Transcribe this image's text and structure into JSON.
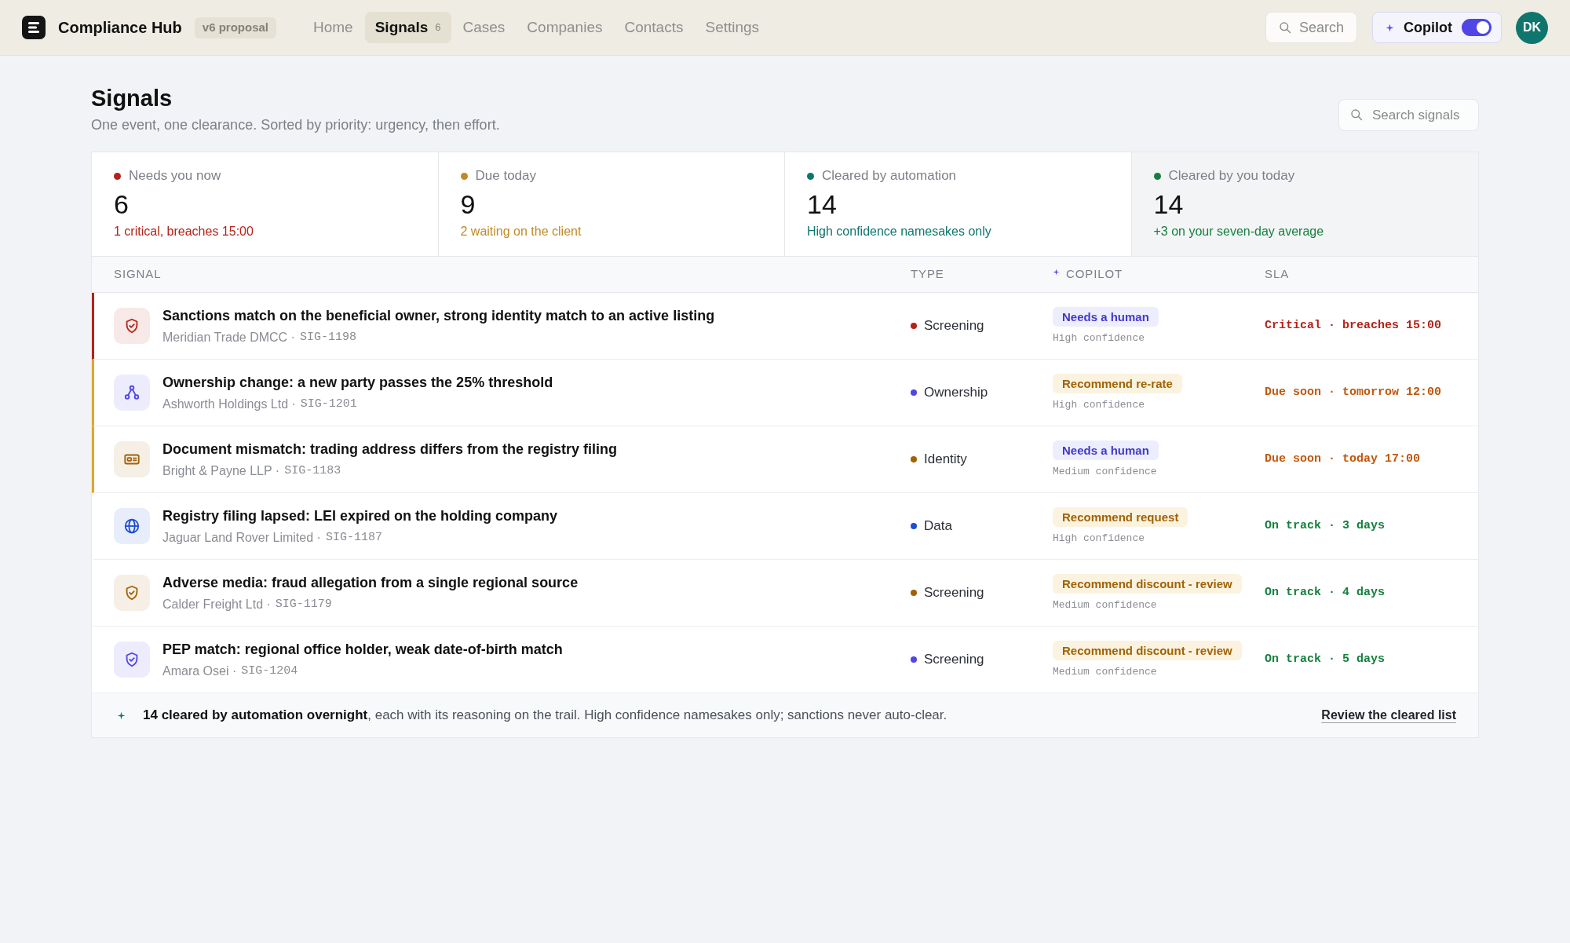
{
  "app": {
    "name": "Compliance Hub",
    "badge": "v6 proposal"
  },
  "nav": [
    {
      "label": "Home",
      "selected": false
    },
    {
      "label": "Signals",
      "selected": true,
      "count": "6"
    },
    {
      "label": "Cases",
      "selected": false
    },
    {
      "label": "Companies",
      "selected": false
    },
    {
      "label": "Contacts",
      "selected": false
    },
    {
      "label": "Settings",
      "selected": false
    }
  ],
  "search_button": {
    "label": "Search"
  },
  "copilot": {
    "label": "Copilot",
    "on": true
  },
  "user": {
    "initials": "DK"
  },
  "page": {
    "title": "Signals",
    "subtitle": "One event, one clearance. Sorted by priority: urgency, then effort.",
    "search": {
      "placeholder": "Search signals"
    }
  },
  "stats": [
    {
      "label": "Needs you now",
      "value": "6",
      "note": "1 critical, breaches 15:00",
      "color": "#b42318",
      "selected": false
    },
    {
      "label": "Due today",
      "value": "9",
      "note": "2 waiting on the client",
      "color": "#c08a26",
      "selected": false
    },
    {
      "label": "Cleared by automation",
      "value": "14",
      "note": "High confidence namesakes only",
      "color": "#0f766e",
      "selected": false
    },
    {
      "label": "Cleared by you today",
      "value": "14",
      "note": "+3 on your seven-day average",
      "color": "#15803d",
      "selected": true
    }
  ],
  "table": {
    "columns": [
      {
        "label": "SIGNAL",
        "kind": "plain"
      },
      {
        "label": "TYPE",
        "kind": "plain"
      },
      {
        "label": "COPILOT",
        "kind": "copilot"
      },
      {
        "label": "SLA",
        "kind": "plain"
      }
    ],
    "rows": [
      {
        "kind": "screening",
        "title": "Sanctions match on the beneficial owner, strong identity match to an active listing",
        "company": "Meridian Trade DMCC ·",
        "ref": "SIG-1198",
        "color": "#b42318",
        "type": "Screening",
        "copilot": {
          "kind": "human",
          "label": "Needs a human",
          "confidence": "High confidence"
        },
        "critical": true,
        "due_soon": false,
        "sla": "Critical · breaches 15:00"
      },
      {
        "kind": "ownership",
        "title": "Ownership change: a new party passes the 25% threshold",
        "company": "Ashworth Holdings Ltd ·",
        "ref": "SIG-1201",
        "color": "#4f46e5",
        "type": "Ownership",
        "copilot": {
          "kind": "recommend",
          "label": "Recommend re-rate",
          "confidence": "High confidence"
        },
        "critical": false,
        "due_soon": true,
        "sla": "Due soon · tomorrow 12:00"
      },
      {
        "kind": "identity",
        "title": "Document mismatch: trading address differs from the registry filing",
        "company": "Bright & Payne LLP ·",
        "ref": "SIG-1183",
        "color": "#a16207",
        "type": "Identity",
        "copilot": {
          "kind": "human",
          "label": "Needs a human",
          "confidence": "Medium confidence"
        },
        "critical": false,
        "due_soon": true,
        "sla": "Due soon · today 17:00"
      },
      {
        "kind": "data",
        "title": "Registry filing lapsed: LEI expired on the holding company",
        "company": "Jaguar Land Rover Limited ·",
        "ref": "SIG-1187",
        "color": "#1d4ed8",
        "type": "Data",
        "copilot": {
          "kind": "recommend",
          "label": "Recommend request",
          "confidence": "High confidence"
        },
        "critical": false,
        "due_soon": false,
        "sla": "On track · 3 days"
      },
      {
        "kind": "screening",
        "title": "Adverse media: fraud allegation from a single regional source",
        "company": "Calder Freight Ltd ·",
        "ref": "SIG-1179",
        "color": "#a16207",
        "type": "Screening",
        "copilot": {
          "kind": "recommend",
          "label": "Recommend discount - review",
          "confidence": "Medium confidence"
        },
        "critical": false,
        "due_soon": false,
        "sla": "On track · 4 days"
      },
      {
        "kind": "screening",
        "title": "PEP match: regional office holder, weak date-of-birth match",
        "company": "Amara Osei ·",
        "ref": "SIG-1204",
        "color": "#4f46e5",
        "type": "Screening",
        "copilot": {
          "kind": "recommend",
          "label": "Recommend discount - review",
          "confidence": "Medium confidence"
        },
        "critical": false,
        "due_soon": false,
        "sla": "On track · 5 days"
      }
    ]
  },
  "footer": {
    "text": "**14 cleared by automation overnight**, each with its reasoning on the trail. High confidence namesakes only; sanctions never auto-clear.",
    "link": "Review the cleared list"
  }
}
